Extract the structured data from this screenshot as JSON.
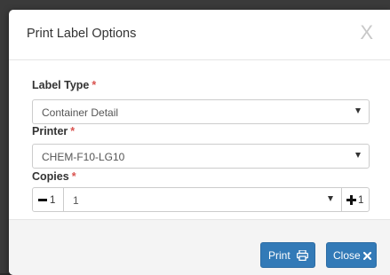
{
  "dialog": {
    "title": "Print Label Options",
    "close_glyph": "X"
  },
  "form": {
    "label_type": {
      "label": "Label Type",
      "required_mark": "*",
      "value": "Container Detail"
    },
    "printer": {
      "label": "Printer",
      "required_mark": "*",
      "value": "CHEM-F10-LG10"
    },
    "copies": {
      "label": "Copies",
      "required_mark": "*",
      "value": "1",
      "decrement_step": "1",
      "increment_step": "1"
    }
  },
  "footer": {
    "print_label": "Print",
    "close_label": "Close"
  },
  "icons": {
    "print": "printer-icon",
    "close": "times-icon",
    "decrement": "minus-icon",
    "increment": "plus-icon",
    "dropdown": "caret-down-icon"
  },
  "colors": {
    "primary_button": "#337ab7",
    "required_asterisk": "#d9534f",
    "footer_bg": "#f4f4f4"
  }
}
